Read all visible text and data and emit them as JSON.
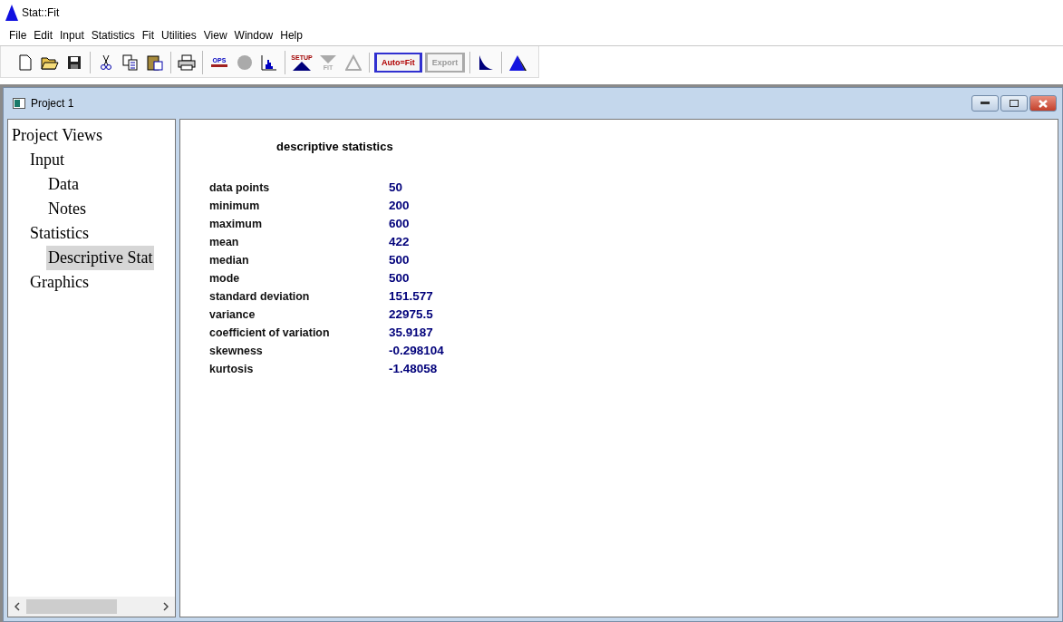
{
  "app": {
    "title": "Stat::Fit"
  },
  "menu": [
    "File",
    "Edit",
    "Input",
    "Statistics",
    "Fit",
    "Utilities",
    "View",
    "Window",
    "Help"
  ],
  "toolbar_groups": [
    [
      {
        "kind": "new"
      },
      {
        "kind": "open"
      },
      {
        "kind": "save"
      }
    ],
    [
      {
        "kind": "cut"
      },
      {
        "kind": "copy"
      },
      {
        "kind": "paste"
      }
    ],
    [
      {
        "kind": "print"
      }
    ],
    [
      {
        "kind": "ops",
        "label": "OPS",
        "disabled": false
      },
      {
        "kind": "circle",
        "disabled": true
      },
      {
        "kind": "histogram",
        "disabled": false
      }
    ],
    [
      {
        "kind": "setup",
        "label": "SETUP",
        "disabled": false
      },
      {
        "kind": "fit",
        "label": "FIT",
        "disabled": true
      },
      {
        "kind": "mountain",
        "disabled": true
      }
    ],
    [
      {
        "kind": "textbutton",
        "label": "Auto=Fit",
        "disabled": false
      },
      {
        "kind": "textbutton",
        "label": "Export",
        "disabled": true
      }
    ],
    [
      {
        "kind": "decay"
      }
    ],
    [
      {
        "kind": "peak"
      }
    ]
  ],
  "window": {
    "title": "Project 1"
  },
  "tree": [
    {
      "label": "Project Views",
      "selected": false,
      "children": [
        {
          "label": "Input",
          "selected": false,
          "children": [
            {
              "label": "Data",
              "selected": false
            },
            {
              "label": "Notes",
              "selected": false
            }
          ]
        },
        {
          "label": "Statistics",
          "selected": false,
          "children": [
            {
              "label": "Descriptive Stat",
              "selected": true
            }
          ]
        },
        {
          "label": "Graphics",
          "selected": false
        }
      ]
    }
  ],
  "report": {
    "title": "descriptive statistics",
    "rows": [
      {
        "name": "data points",
        "value": "50"
      },
      {
        "name": "minimum",
        "value": "200"
      },
      {
        "name": "maximum",
        "value": "600"
      },
      {
        "name": "mean",
        "value": "422"
      },
      {
        "name": "median",
        "value": "500"
      },
      {
        "name": "mode",
        "value": "500"
      },
      {
        "name": "standard deviation",
        "value": "151.577"
      },
      {
        "name": "variance",
        "value": "22975.5"
      },
      {
        "name": "coefficient of variation",
        "value": "35.9187"
      },
      {
        "name": "skewness",
        "value": "-0.298104"
      },
      {
        "name": "kurtosis",
        "value": "-1.48058"
      }
    ]
  }
}
